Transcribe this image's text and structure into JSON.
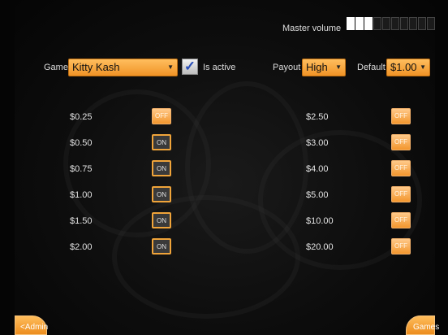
{
  "volume": {
    "label": "Master volume",
    "level": 3,
    "max": 10
  },
  "game": {
    "label": "Game",
    "value": "Kitty Kash",
    "active_label": "Is active",
    "active": true
  },
  "payout": {
    "label": "Payout",
    "value": "High"
  },
  "default": {
    "label": "Default",
    "value": "$1.00"
  },
  "left_denoms": [
    {
      "price": "$0.25",
      "state": "OFF"
    },
    {
      "price": "$0.50",
      "state": "ON"
    },
    {
      "price": "$0.75",
      "state": "ON"
    },
    {
      "price": "$1.00",
      "state": "ON"
    },
    {
      "price": "$1.50",
      "state": "ON"
    },
    {
      "price": "$2.00",
      "state": "ON"
    }
  ],
  "right_denoms": [
    {
      "price": "$2.50",
      "state": "OFF"
    },
    {
      "price": "$3.00",
      "state": "OFF"
    },
    {
      "price": "$4.00",
      "state": "OFF"
    },
    {
      "price": "$5.00",
      "state": "OFF"
    },
    {
      "price": "$10.00",
      "state": "OFF"
    },
    {
      "price": "$20.00",
      "state": "OFF"
    }
  ],
  "nav": {
    "admin_label": "<Admin",
    "games_label": "Games"
  },
  "colors": {
    "accent": "#f39a2c",
    "background": "#0d0d0d"
  }
}
